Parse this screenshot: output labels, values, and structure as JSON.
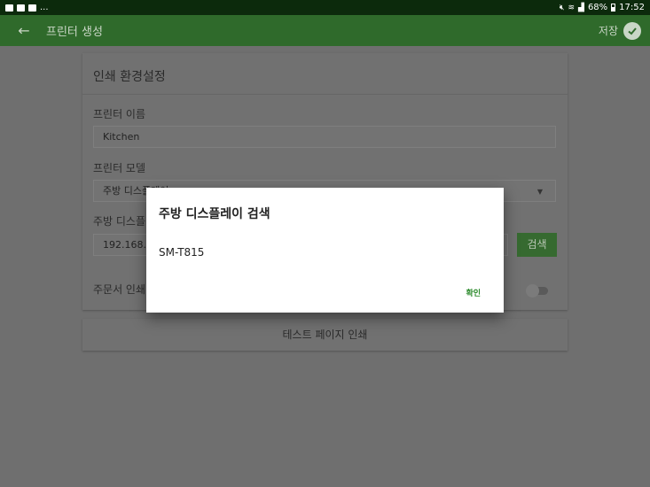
{
  "status_bar": {
    "left_icons": [
      "image-icon",
      "doc-icon",
      "mail-icon"
    ],
    "more": "...",
    "battery": "68%",
    "time": "17:52"
  },
  "app_bar": {
    "title": "프린터 생성",
    "save_label": "저장"
  },
  "settings": {
    "section_title": "인쇄 환경설정",
    "printer_name_label": "프린터 이름",
    "printer_name_value": "Kitchen",
    "printer_model_label": "프린터 모델",
    "printer_model_value": "주방 디스플레이",
    "kitchen_display_label": "주방 디스플레",
    "ip_value": "192.168.5",
    "search_label": "검색",
    "order_print_label": "주문서 인쇄",
    "test_print_label": "테스트 페이지 인쇄"
  },
  "dialog": {
    "title": "주방 디스플레이 검색",
    "items": [
      "SM-T815"
    ],
    "confirm_label": "확인"
  },
  "colors": {
    "app_bar": "#2f6a2b",
    "status_bar": "#0c2a0c",
    "accent": "#2e8b2e"
  }
}
